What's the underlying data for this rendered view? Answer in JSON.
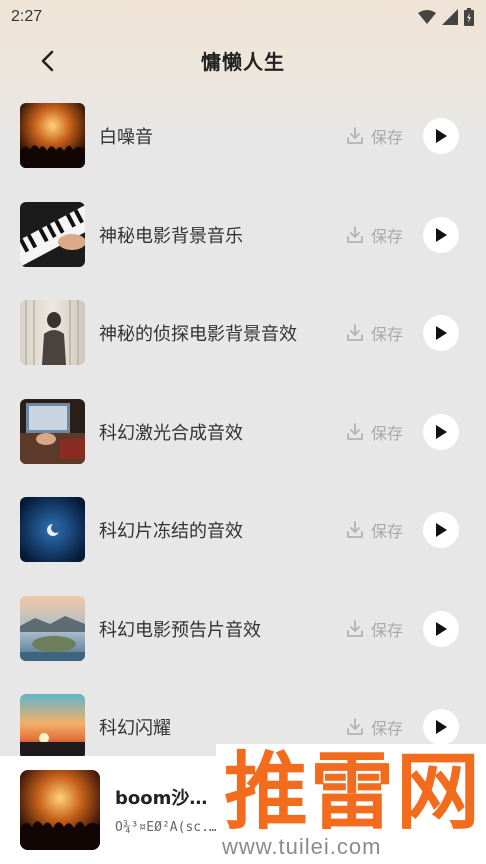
{
  "status": {
    "time": "2:27"
  },
  "header": {
    "title": "慵懒人生"
  },
  "save_label": "保存",
  "items": [
    {
      "title": "白噪音",
      "thumb": "concert-crowd"
    },
    {
      "title": "神秘电影背景音乐",
      "thumb": "piano-keys"
    },
    {
      "title": "神秘的侦探电影背景音效",
      "thumb": "silhouette-curtain"
    },
    {
      "title": "科幻激光合成音效",
      "thumb": "laptop-desk"
    },
    {
      "title": "科幻片冻结的音效",
      "thumb": "night-moon"
    },
    {
      "title": "科幻电影预告片音效",
      "thumb": "coastal-island"
    },
    {
      "title": "科幻闪耀",
      "thumb": "sunset-horizon"
    }
  ],
  "mini_player": {
    "title": "boom沙卡...",
    "subtitle": "Õ¾³¤ËØ²Ä(sc..."
  },
  "watermark": {
    "brand": "推雷网",
    "url": "www.tuilei.com"
  },
  "colors": {
    "accent_orange": "#f36b1c",
    "muted_gray": "#a9a9a9",
    "background": "#e7e7e7"
  }
}
